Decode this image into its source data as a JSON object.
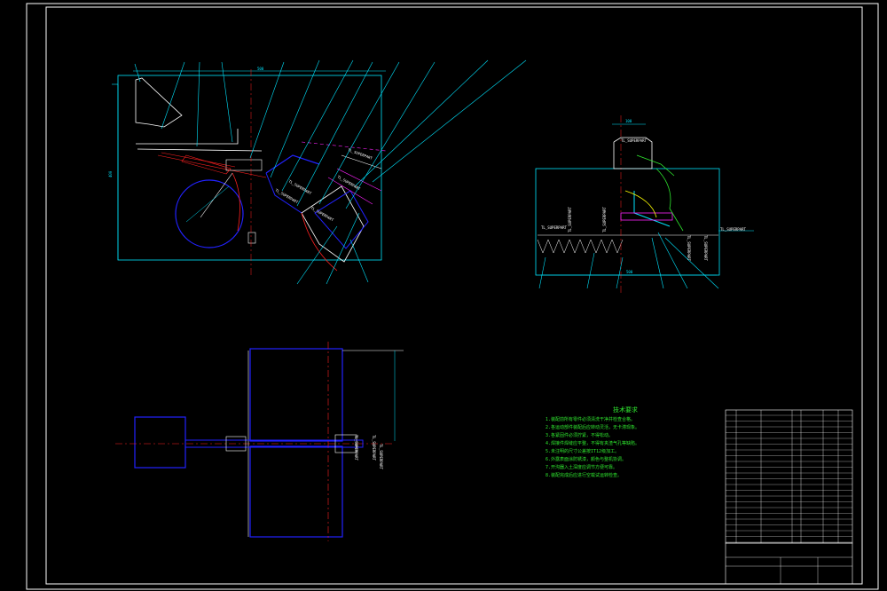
{
  "drawing": {
    "super_part_label": "TL_SUPERPART",
    "technical_notes_title": "技术要求",
    "technical_notes": [
      "1.装配前所有零件必须清洗干净并检查合格。",
      "2.各运动部件装配后应转动灵活，无卡滞现象。",
      "3.各紧固件必须拧紧，不得松动。",
      "4.焊接件焊缝应平整，不得有夹渣气孔等缺陷。",
      "5.未注明的尺寸公差按IT12级加工。",
      "6.外露表面涂防锈漆，颜色与整机协调。",
      "7.开沟器入土深度应调节方便可靠。",
      "8.装配完成后应进行空载试运转检查。"
    ]
  },
  "colors": {
    "background": "#000000",
    "frame": "#ffffff",
    "outline": "#00e5ff",
    "part": "#2222ff",
    "center": "#ff2020",
    "notes": "#2fe82f",
    "bom_text": "#ff22ff",
    "bom_grid": "#ffffff"
  }
}
